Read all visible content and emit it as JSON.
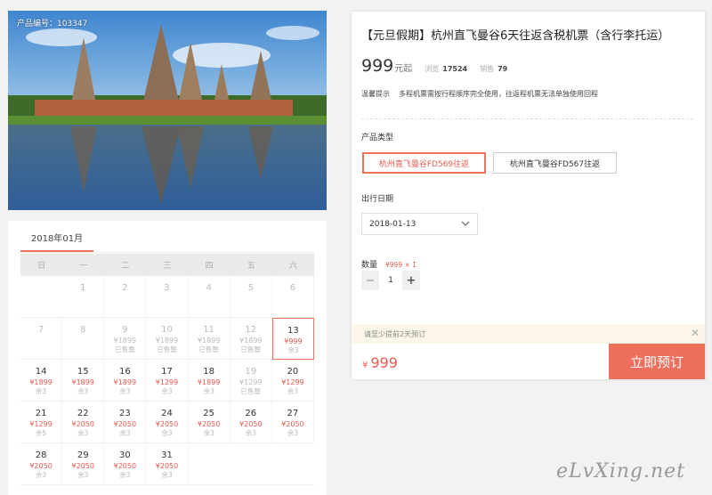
{
  "product": {
    "code_label": "产品编号：103347",
    "title": "【元旦假期】杭州直飞曼谷6天往返含税机票（含行李托运）",
    "price": "999",
    "price_unit": "元起",
    "views_label": "浏览",
    "views": "17524",
    "sales_label": "销售",
    "sales": "79",
    "tip_label": "温馨提示",
    "tip_text": "多程机票需按行程顺序完全使用，往返程机票无法单独使用回程"
  },
  "options": {
    "type_label": "产品类型",
    "types": [
      "杭州直飞曼谷FD569往返",
      "杭州直飞曼谷FD567往返"
    ],
    "date_label": "出行日期",
    "date_value": "2018-01-13",
    "qty_label": "数量",
    "qty_sub": "¥999 × 1",
    "qty_value": "1",
    "qty_minus": "−",
    "qty_plus": "+"
  },
  "notice": {
    "text": "请至少提前2天预订",
    "close": "✕"
  },
  "checkout": {
    "currency": "¥",
    "total": "999",
    "book_label": "立即预订"
  },
  "calendar": {
    "month_tab": "2018年01月",
    "weekdays": [
      "日",
      "一",
      "二",
      "三",
      "四",
      "五",
      "六"
    ],
    "days": [
      {
        "num": "",
        "price": "",
        "stock": ""
      },
      {
        "num": "1",
        "price": "",
        "stock": "",
        "muted": true
      },
      {
        "num": "2",
        "price": "",
        "stock": "",
        "muted": true
      },
      {
        "num": "3",
        "price": "",
        "stock": "",
        "muted": true
      },
      {
        "num": "4",
        "price": "",
        "stock": "",
        "muted": true
      },
      {
        "num": "5",
        "price": "",
        "stock": "",
        "muted": true
      },
      {
        "num": "6",
        "price": "",
        "stock": "",
        "muted": true
      },
      {
        "num": "7",
        "price": "",
        "stock": "",
        "muted": true
      },
      {
        "num": "8",
        "price": "",
        "stock": "",
        "muted": true
      },
      {
        "num": "9",
        "price": "¥1899",
        "stock": "已售罄",
        "muted": true
      },
      {
        "num": "10",
        "price": "¥1899",
        "stock": "已售罄",
        "muted": true
      },
      {
        "num": "11",
        "price": "¥1899",
        "stock": "已售罄",
        "muted": true
      },
      {
        "num": "12",
        "price": "¥1899",
        "stock": "已售罄",
        "muted": true
      },
      {
        "num": "13",
        "price": "¥999",
        "stock": "余3",
        "selected": true
      },
      {
        "num": "14",
        "price": "¥1899",
        "stock": "余3"
      },
      {
        "num": "15",
        "price": "¥1899",
        "stock": "余3"
      },
      {
        "num": "16",
        "price": "¥1899",
        "stock": "余3"
      },
      {
        "num": "17",
        "price": "¥1299",
        "stock": "余3"
      },
      {
        "num": "18",
        "price": "¥1899",
        "stock": "余3"
      },
      {
        "num": "19",
        "price": "¥1299",
        "stock": "已售罄",
        "muted": true
      },
      {
        "num": "20",
        "price": "¥1299",
        "stock": "余3"
      },
      {
        "num": "21",
        "price": "¥1299",
        "stock": "余5"
      },
      {
        "num": "22",
        "price": "¥2050",
        "stock": "余3"
      },
      {
        "num": "23",
        "price": "¥2050",
        "stock": "余3"
      },
      {
        "num": "24",
        "price": "¥2050",
        "stock": "余3"
      },
      {
        "num": "25",
        "price": "¥2050",
        "stock": "余3"
      },
      {
        "num": "26",
        "price": "¥2050",
        "stock": "余3"
      },
      {
        "num": "27",
        "price": "¥2050",
        "stock": "余3"
      },
      {
        "num": "28",
        "price": "¥2050",
        "stock": "余3"
      },
      {
        "num": "29",
        "price": "¥2050",
        "stock": "余3"
      },
      {
        "num": "30",
        "price": "¥2050",
        "stock": "余3"
      },
      {
        "num": "31",
        "price": "¥2050",
        "stock": "余3"
      },
      {
        "num": "",
        "price": "",
        "stock": ""
      },
      {
        "num": "",
        "price": "",
        "stock": ""
      },
      {
        "num": "",
        "price": "",
        "stock": ""
      }
    ]
  },
  "watermark": "eLvXing.net",
  "colors": {
    "accent": "#ef6f5d",
    "price_red": "#e85a50",
    "notice_bg": "#fcf6e8"
  }
}
